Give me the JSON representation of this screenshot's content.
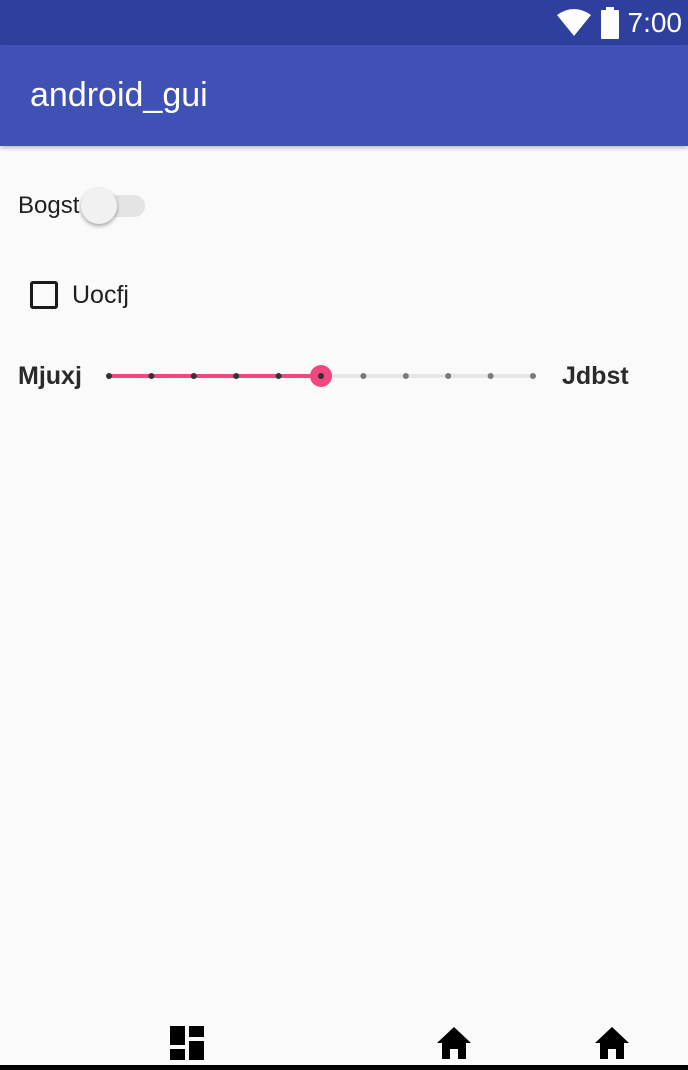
{
  "status_bar": {
    "time": "7:00",
    "icons": [
      "wifi-icon",
      "battery-icon"
    ],
    "background": "#2f3f9e"
  },
  "app_bar": {
    "title": "android_gui",
    "background": "#3f51b5"
  },
  "switch": {
    "label": "Bogst",
    "checked": false
  },
  "checkbox": {
    "label": "Uocfj",
    "checked": false
  },
  "slider": {
    "min_label": "Mjuxj",
    "max_label": "Jdbst",
    "min": 0,
    "max": 10,
    "value": 5,
    "accent_color": "#f0487e"
  },
  "nav_bar": {
    "icons": [
      "dashboard-icon",
      "home-icon",
      "home-icon"
    ]
  }
}
